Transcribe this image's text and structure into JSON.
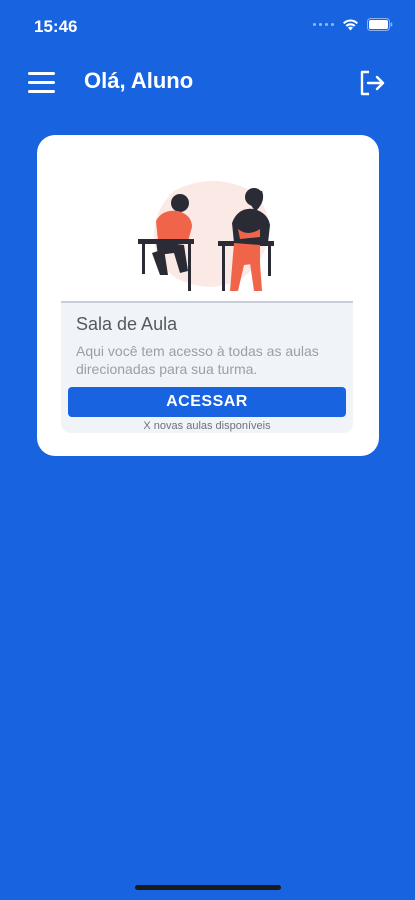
{
  "status": {
    "time": "15:46"
  },
  "header": {
    "greeting": "Olá, Aluno"
  },
  "card": {
    "title": "Sala de Aula",
    "description": "Aqui você tem acesso à todas as aulas direcionadas para sua turma.",
    "button_label": "ACESSAR",
    "footnote": "X novas aulas disponíveis"
  },
  "colors": {
    "background": "#1763e0",
    "accent": "#1763e0",
    "illustration_person": "#f0654a"
  },
  "icons": [
    "menu-icon",
    "logout-icon",
    "wifi-icon",
    "battery-icon",
    "signal-icon"
  ]
}
